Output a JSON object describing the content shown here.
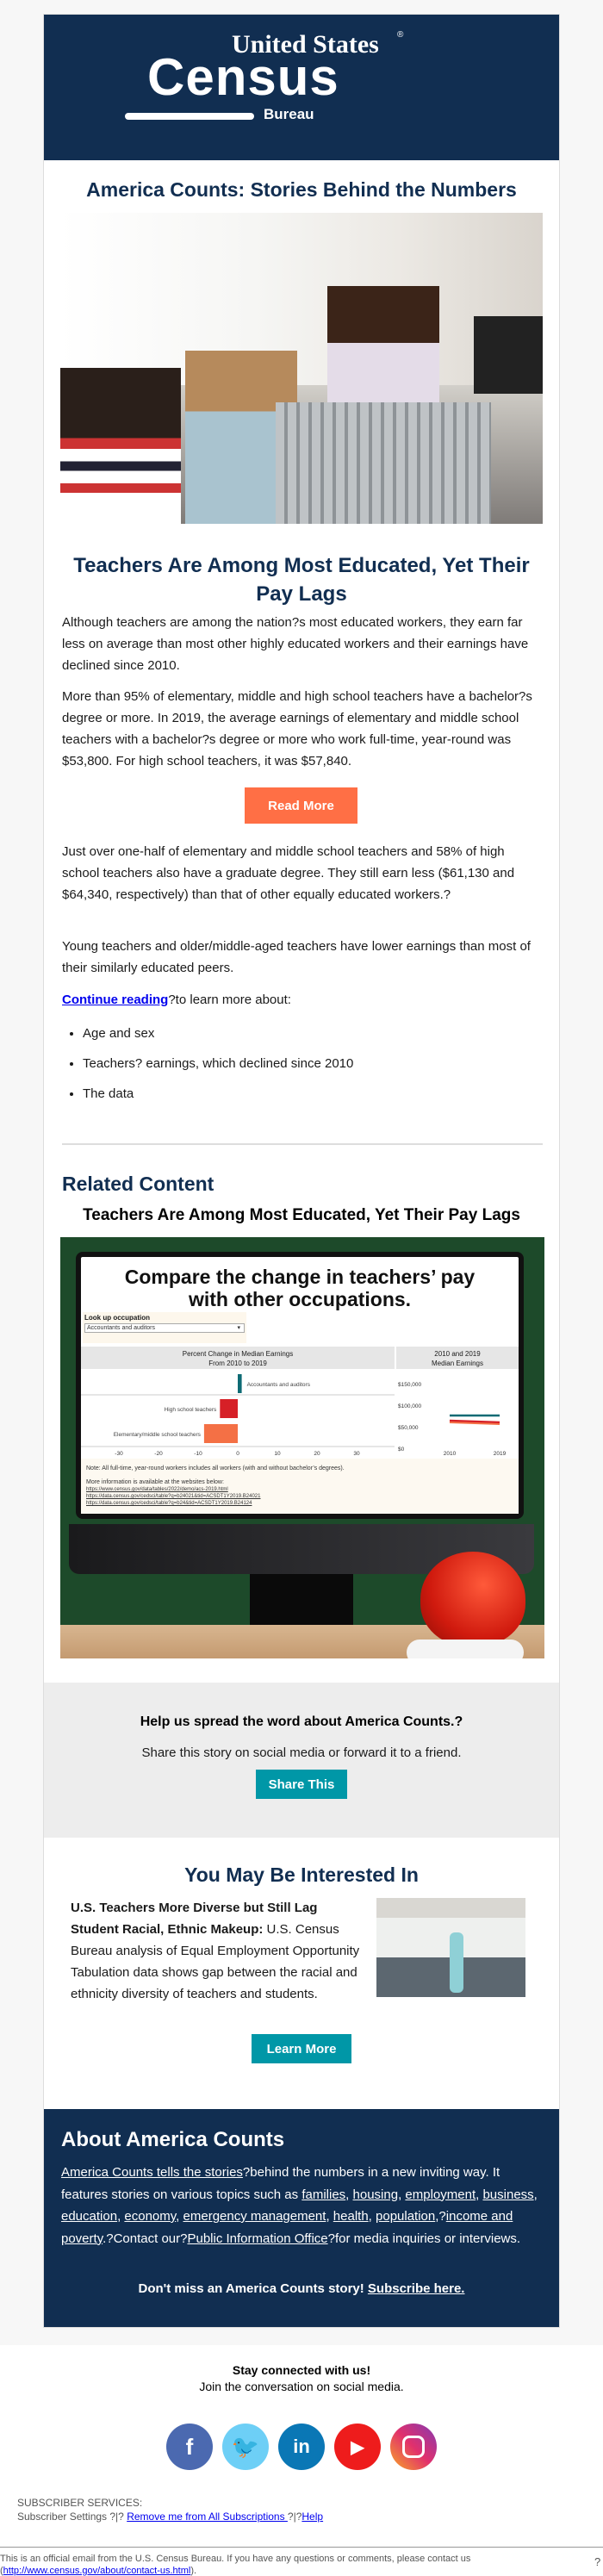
{
  "logo": {
    "line1": "United States",
    "line2": "Census",
    "line3": "Bureau",
    "mark": "®"
  },
  "series_title": "America Counts: Stories Behind the Numbers",
  "article": {
    "title": "Teachers Are Among Most Educated, Yet Their Pay Lags",
    "p1": "Although teachers are among the nation?s most educated workers, they earn far less on average than most other highly educated workers and their earnings have declined since 2010.",
    "p2": "More than 95% of elementary, middle and high school teachers have a bachelor?s degree or more. In 2019, the average earnings of elementary and middle school teachers with a bachelor?s degree or more who work full-time, year-round was $53,800. For high school teachers, it was $57,840.",
    "read_more": "Read More",
    "p3": "Just over one-half of elementary and middle school teachers and 58% of high school teachers also have a graduate degree. They still earn less ($61,130 and $64,340, respectively) than that of other equally educated workers.?",
    "p4": "Young teachers and older/middle-aged teachers have lower earnings than most of their similarly educated peers.",
    "continue_link": "Continue reading",
    "continue_rest": "?to learn more about:",
    "bullets": [
      "Age and sex",
      "Teachers? earnings, which declined since 2010",
      "The data"
    ]
  },
  "related": {
    "heading": "Related Content",
    "subheading": "Teachers Are Among Most Educated, Yet Their Pay Lags",
    "graphic": {
      "title1": "Compare the change in teachers’ pay",
      "title2": "with other occupations.",
      "lookup_label": "Look up occupation",
      "lookup_value": "Accountants and auditors",
      "left_header1": "Percent Change in Median Earnings",
      "left_header2": "From 2010 to 2019",
      "right_header1": "2010 and 2019",
      "right_header2": "Median Earnings",
      "bars": [
        {
          "label": "Accountants and auditors",
          "value": 1,
          "color": "#0e6b74"
        },
        {
          "label": "High school teachers",
          "value": -4.5,
          "color": "#d62027"
        },
        {
          "label": "Elementary/middle school teachers",
          "value": -8.5,
          "color": "#f47045"
        }
      ],
      "x_ticks": [
        "-30",
        "-20",
        "-10",
        "0",
        "10",
        "20",
        "30"
      ],
      "y_ticks": [
        "$150,000",
        "$100,000",
        "$50,000",
        "$0"
      ],
      "years": [
        "2010",
        "2019"
      ],
      "note": "Note: All full-time, year-round workers includes all workers (with and without bachelor’s degrees).",
      "more_info": "More information is available at the websites below:",
      "links": [
        "https://www.census.gov/data/tables/2022/demo/acs-2019.html",
        "https://data.census.gov/cedsci/table?q=b24021&tid=ACSDT1Y2019.B24021",
        "https://data.census.gov/cedsci/table?q=b24&tid=ACSDT1Y2019.B24124"
      ]
    }
  },
  "share": {
    "heading": "Help us spread the word about America Counts.?",
    "text": "Share this story on social media or forward it to a friend.",
    "button": "Share This"
  },
  "interest": {
    "heading": "You May Be Interested In",
    "bold": "U.S. Teachers More Diverse but Still Lag Student Racial, Ethnic Makeup:",
    "text": " U.S. Census Bureau analysis of Equal Employment Opportunity Tabulation data shows gap between the racial and ethnicity diversity of teachers and students.",
    "button": "Learn More"
  },
  "about": {
    "heading": "About America Counts",
    "link1": "America Counts tells the stories",
    "t1": "?behind the numbers in a new inviting way. It features stories on various topics such as ",
    "topics": [
      "families",
      "housing",
      "employment",
      "business",
      "education",
      "economy",
      "emergency management",
      "health",
      "population"
    ],
    "t2": ",?",
    "topic_last": "income and poverty",
    "t3": ".?Contact our?",
    "pio": "Public Information Office",
    "t4": "?for media inquiries or interviews.",
    "subscribe_text": "Don't miss an America Counts story! ",
    "subscribe_link": "Subscribe here."
  },
  "social": {
    "heading": "Stay connected with us!",
    "text": "Join the conversation on social media.",
    "icons": [
      "facebook-icon",
      "twitter-icon",
      "linkedin-icon",
      "youtube-icon",
      "instagram-icon"
    ]
  },
  "footer": {
    "services": "SUBSCRIBER SERVICES:",
    "settings": "Subscriber Settings ?|? ",
    "remove": "Remove me from All Subscriptions ",
    "sep": "?|?",
    "help": "Help",
    "official": "This is an official email from the U.S. Census Bureau. If you have any questions or comments, please contact us",
    "contact_open": "(",
    "contact_link": "http://www.census.gov/about/contact-us.html",
    "contact_close": ").",
    "q": "?"
  },
  "colors": {
    "navy": "#112e51",
    "orange": "#ff6f45",
    "teal": "#0097a7"
  }
}
